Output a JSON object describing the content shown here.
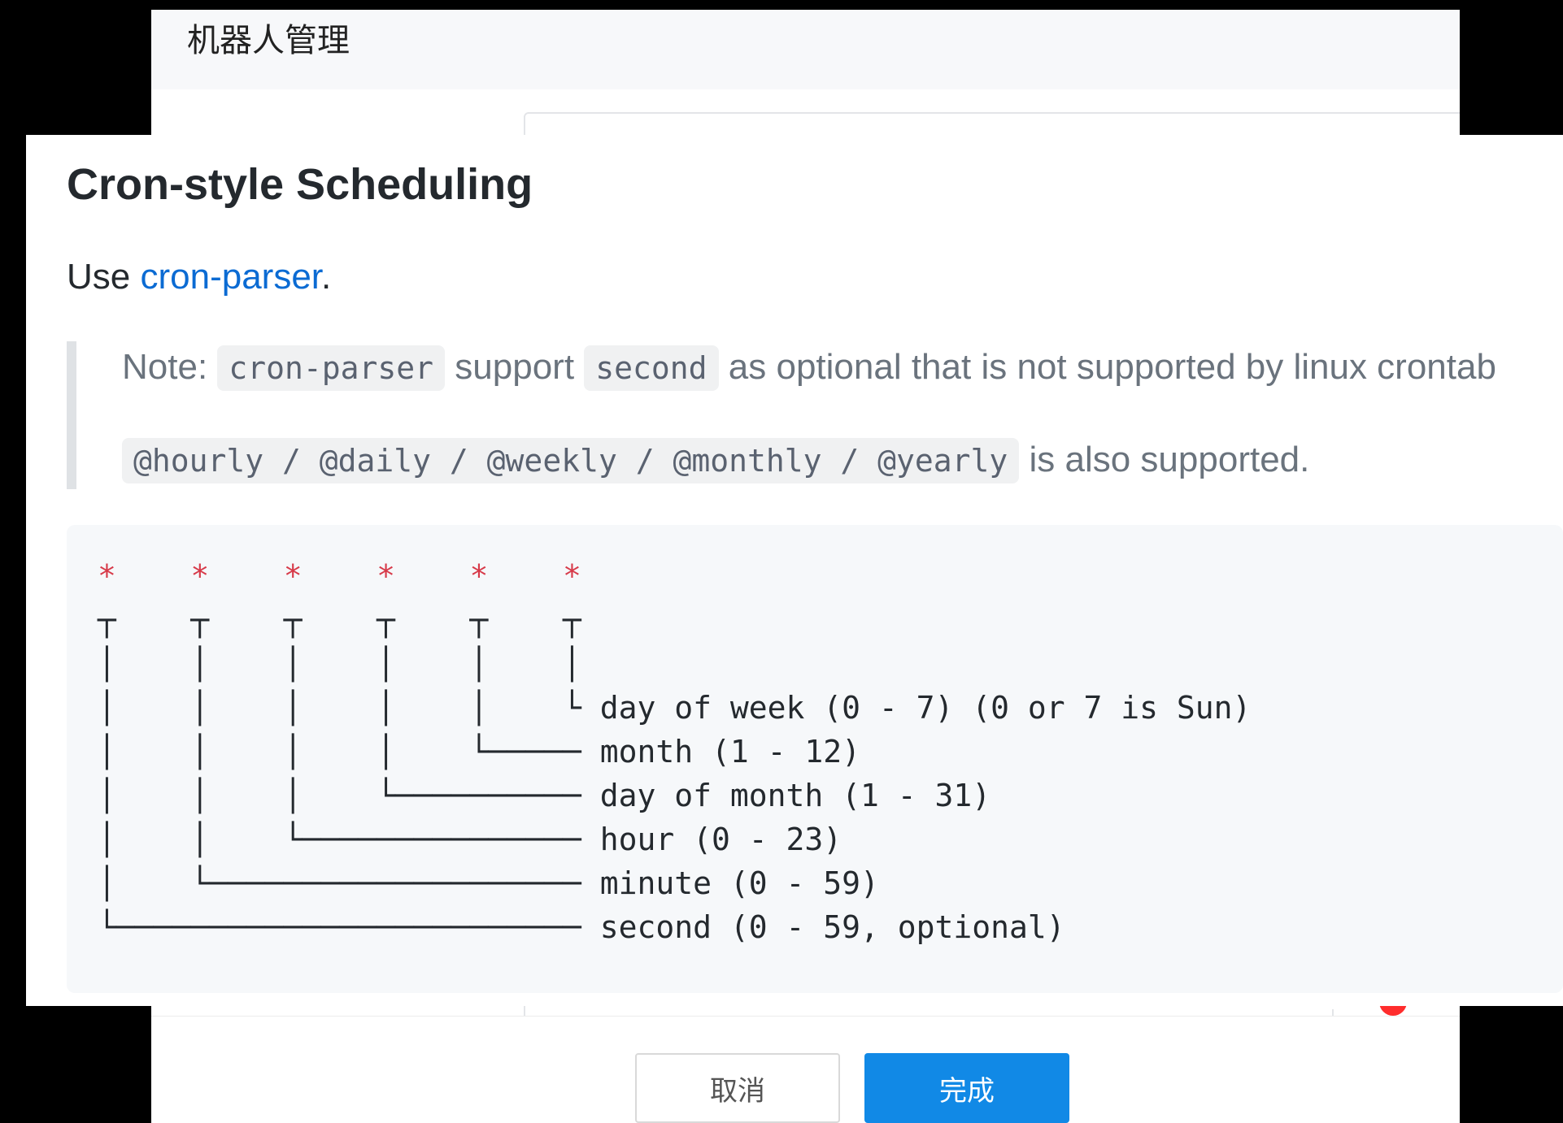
{
  "background_dialog": {
    "title": "机器人管理",
    "cancel_label": "取消",
    "confirm_label": "完成"
  },
  "help": {
    "title": "Cron-style Scheduling",
    "use_prefix": "Use ",
    "use_link": "cron-parser",
    "use_suffix": ".",
    "note_prefix": "Note: ",
    "note_code1": "cron-parser",
    "note_mid": " support ",
    "note_code2": "second",
    "note_suffix": " as optional that is not supported by linux crontab",
    "aliases_code": "@hourly / @daily / @weekly / @monthly / @yearly",
    "aliases_suffix": " is also supported.",
    "diagram": {
      "stars": "*    *    *    *    *    *",
      "lines": [
        "┬    ┬    ┬    ┬    ┬    ┬",
        "│    │    │    │    │    │",
        "│    │    │    │    │    └ day of week (0 - 7) (0 or 7 is Sun)",
        "│    │    │    │    └───── month (1 - 12)",
        "│    │    │    └────────── day of month (1 - 31)",
        "│    │    └─────────────── hour (0 - 23)",
        "│    └──────────────────── minute (0 - 59)",
        "└───────────────────────── second (0 - 59, optional)"
      ]
    }
  }
}
